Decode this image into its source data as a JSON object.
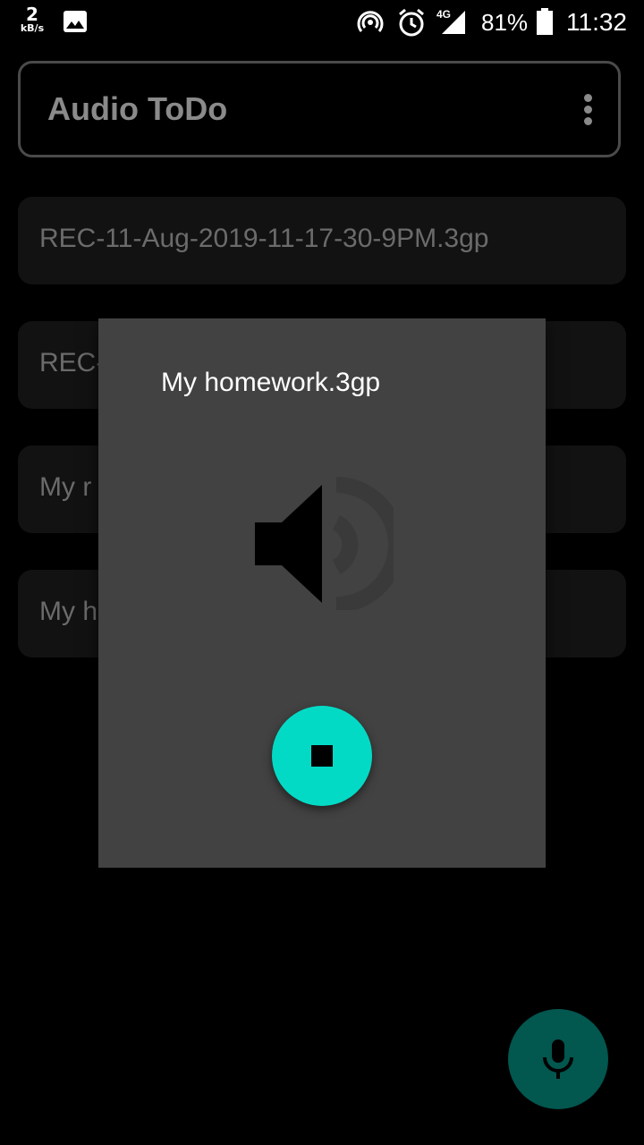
{
  "status_bar": {
    "net_speed_value": "2",
    "net_speed_unit": "kB/s",
    "network_type": "4G",
    "battery_percent": "81%",
    "time": "11:32"
  },
  "app_bar": {
    "title": "Audio ToDo",
    "menu_icon": "overflow-vertical-icon"
  },
  "recordings": [
    {
      "label": "REC-11-Aug-2019-11-17-30-9PM.3gp"
    },
    {
      "label": "REC-"
    },
    {
      "label": "My r"
    },
    {
      "label": "My h"
    }
  ],
  "dialog": {
    "title": "My homework.3gp",
    "icon": "volume-up-icon",
    "button_icon": "stop-icon"
  },
  "fab": {
    "icon": "mic-icon"
  },
  "colors": {
    "accent": "#03dac5",
    "fab": "#02574f",
    "dialog_bg": "#424242",
    "list_item_bg": "#121212"
  }
}
